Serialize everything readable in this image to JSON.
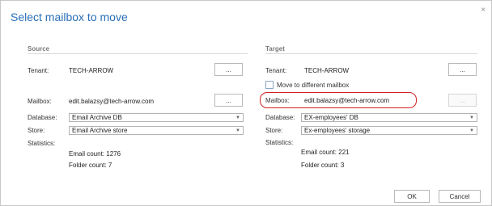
{
  "dialog": {
    "title": "Select mailbox to move",
    "close_glyph": "×"
  },
  "source": {
    "heading": "Source",
    "tenant_label": "Tenant:",
    "tenant_value": "TECH-ARROW",
    "tenant_button": "...",
    "mailbox_label": "Mailbox:",
    "mailbox_value": "edit.balazsy@tech-arrow.com",
    "mailbox_button": "...",
    "database_label": "Database:",
    "database_value": "Email Archive DB",
    "store_label": "Store:",
    "store_value": "Email Archive store",
    "statistics_label": "Statistics:",
    "email_count": "Email count: 1276",
    "folder_count": "Folder count: 7"
  },
  "target": {
    "heading": "Target",
    "tenant_label": "Tenant:",
    "tenant_value": "TECH-ARROW",
    "tenant_button": "...",
    "move_checkbox_label": "Move to different mailbox",
    "move_checkbox_checked": false,
    "mailbox_label": "Mailbox:",
    "mailbox_value": "edit.balazsy@tech-arrow.com",
    "mailbox_button": "...",
    "database_label": "Database:",
    "database_value": "EX-employees' DB",
    "store_label": "Store:",
    "store_value": "Ex-employees' storage",
    "statistics_label": "Statistics:",
    "email_count": "Email count: 221",
    "folder_count": "Folder count: 3"
  },
  "footer": {
    "ok_label": "OK",
    "cancel_label": "Cancel"
  },
  "colors": {
    "title": "#2a6fb8",
    "highlight": "#d42020"
  },
  "icons": {
    "close": "close-icon",
    "dropdown": "chevron-down-icon"
  }
}
